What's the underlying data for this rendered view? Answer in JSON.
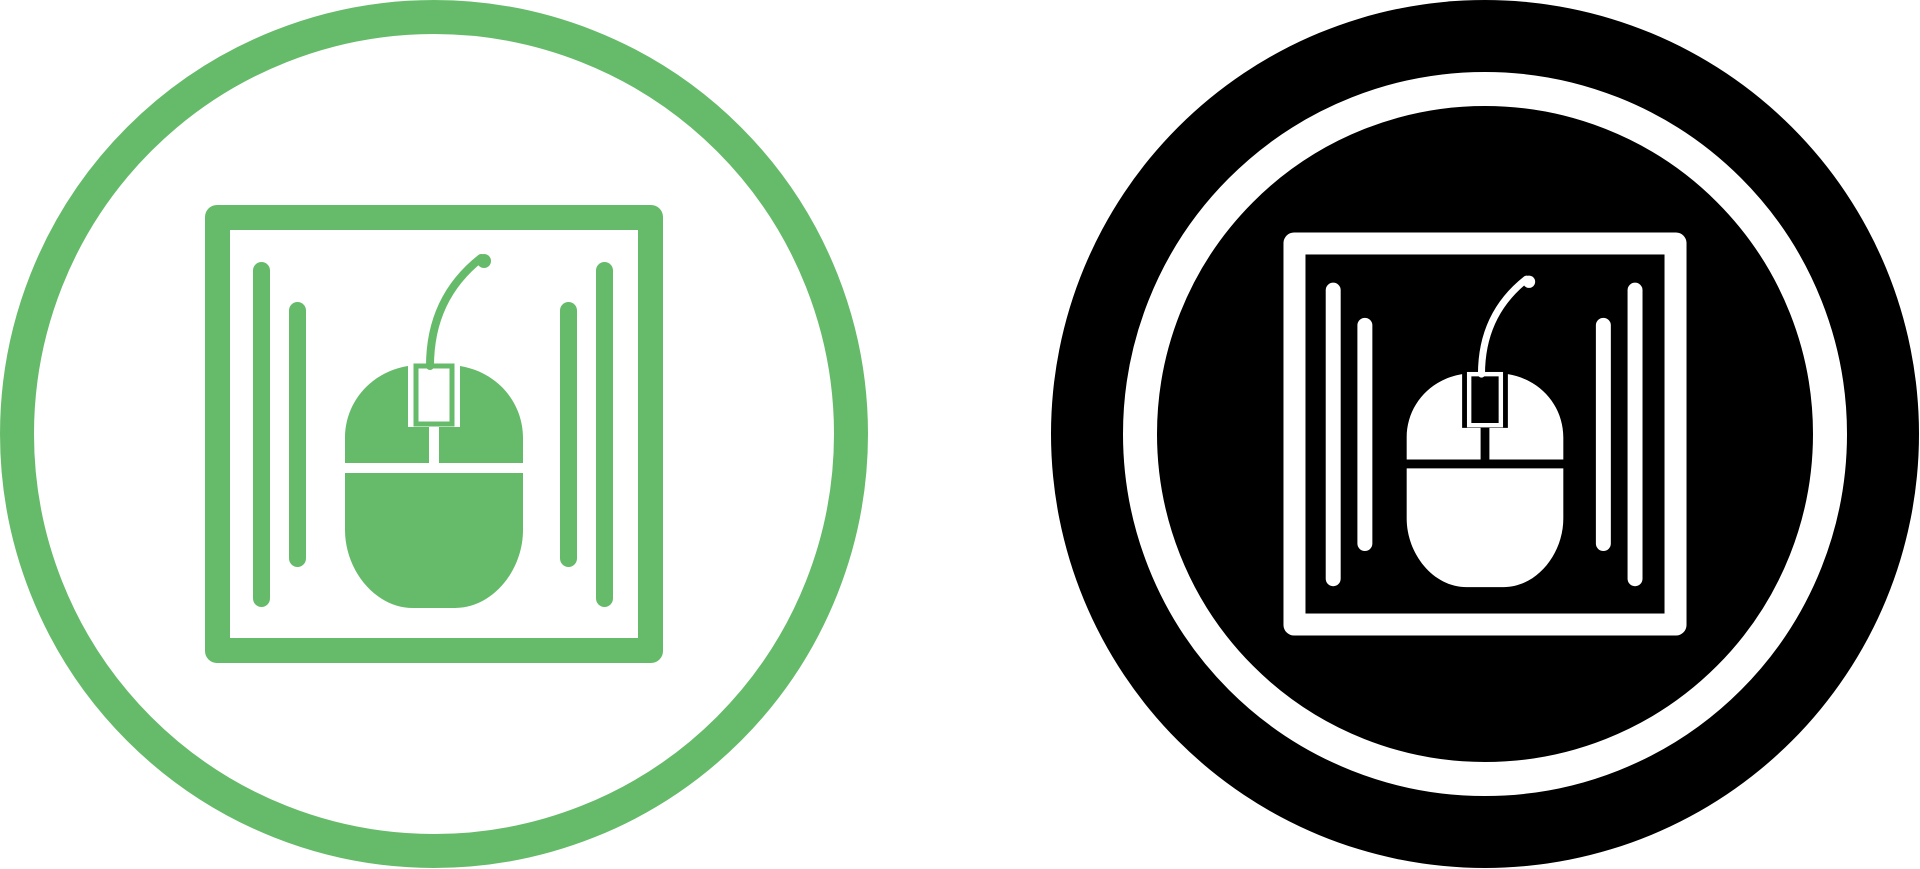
{
  "icons": [
    {
      "name": "mouse-pad-icon-outline",
      "style": "outline",
      "colors": {
        "primary": "#66BB6A",
        "background": "#FFFFFF"
      }
    },
    {
      "name": "mouse-pad-icon-filled",
      "style": "filled",
      "colors": {
        "primary": "#000000",
        "background": "#FFFFFF"
      }
    }
  ]
}
